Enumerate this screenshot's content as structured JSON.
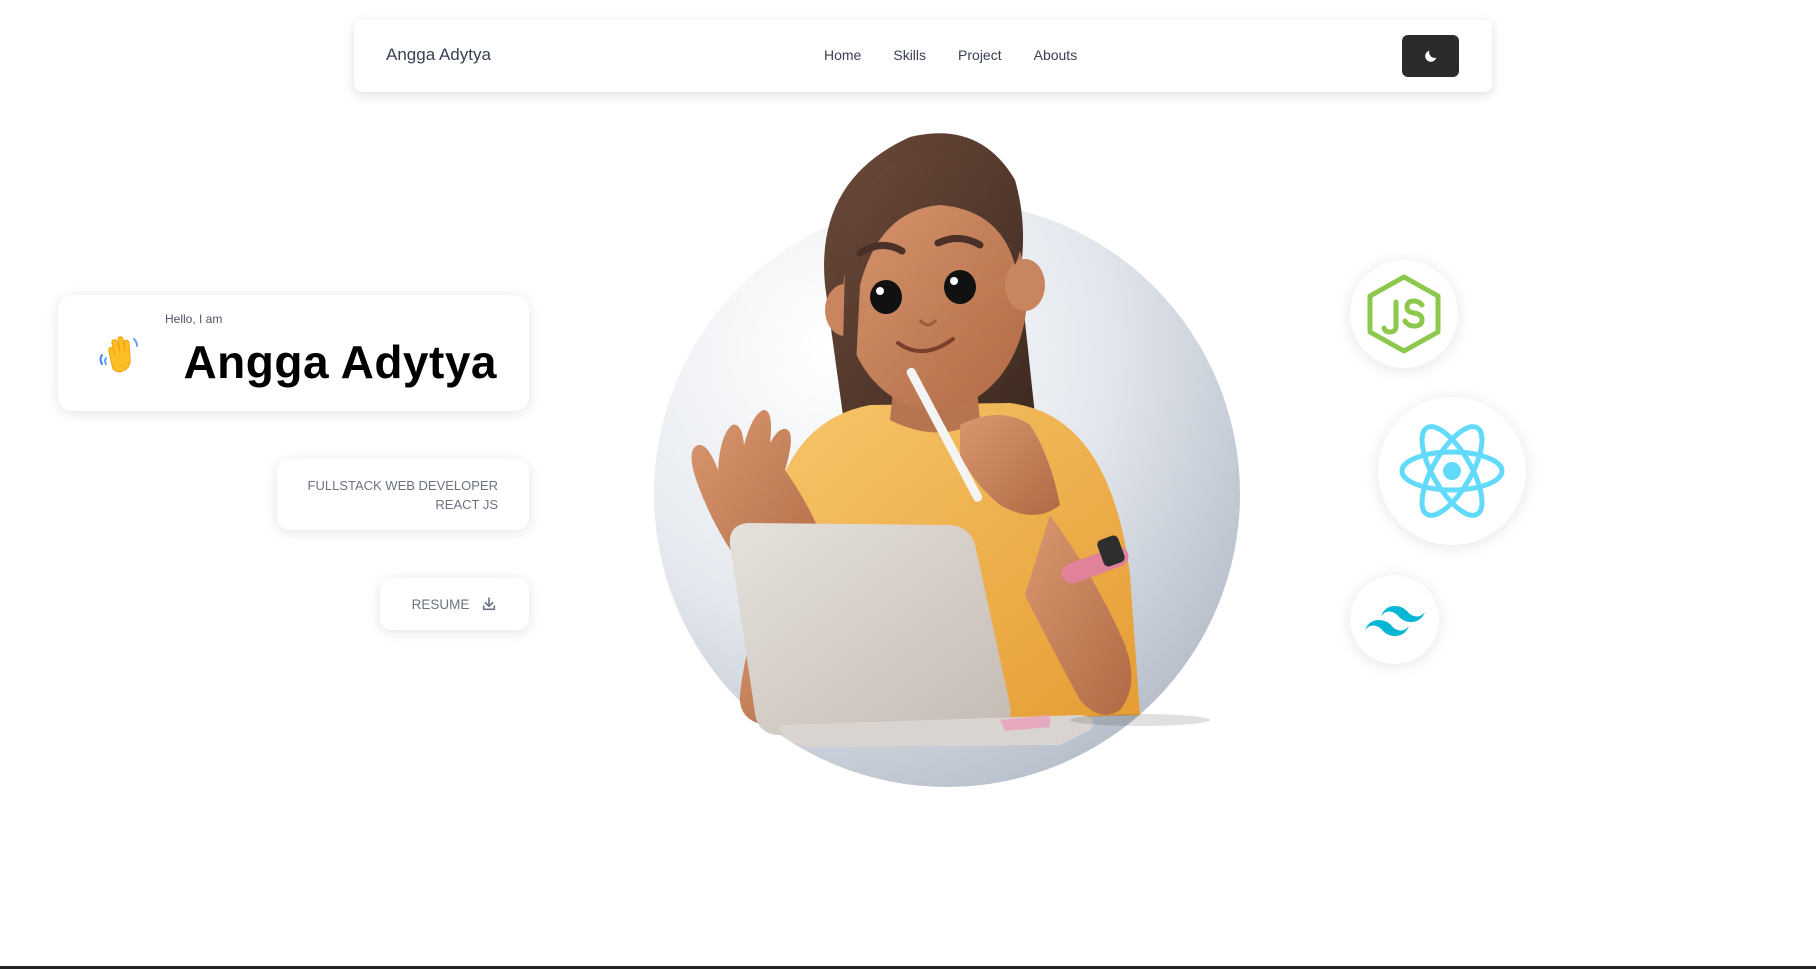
{
  "navbar": {
    "brand": "Angga Adytya",
    "links": [
      "Home",
      "Skills",
      "Project",
      "Abouts"
    ],
    "theme_toggle_icon": "moon-icon"
  },
  "hero": {
    "greeting": "Hello, I am",
    "name": "Angga Adytya",
    "wave_icon": "waving-hand-icon",
    "role_lines": [
      "FULLSTACK WEB DEVELOPER",
      "REACT JS"
    ],
    "resume_label": "RESUME",
    "resume_icon": "download-icon",
    "illustration": "3d-avatar-with-laptop-illustration"
  },
  "tech_stack": [
    {
      "name": "nodejs-logo-icon",
      "color": "#8cc84b"
    },
    {
      "name": "react-logo-icon",
      "color": "#61dafb"
    },
    {
      "name": "tailwind-logo-icon",
      "color": "#06b6d4"
    }
  ],
  "colors": {
    "text_dark": "#374151",
    "text_muted": "#6b7280",
    "toggle_bg": "#2b2b2b",
    "background": "#ffffff"
  }
}
